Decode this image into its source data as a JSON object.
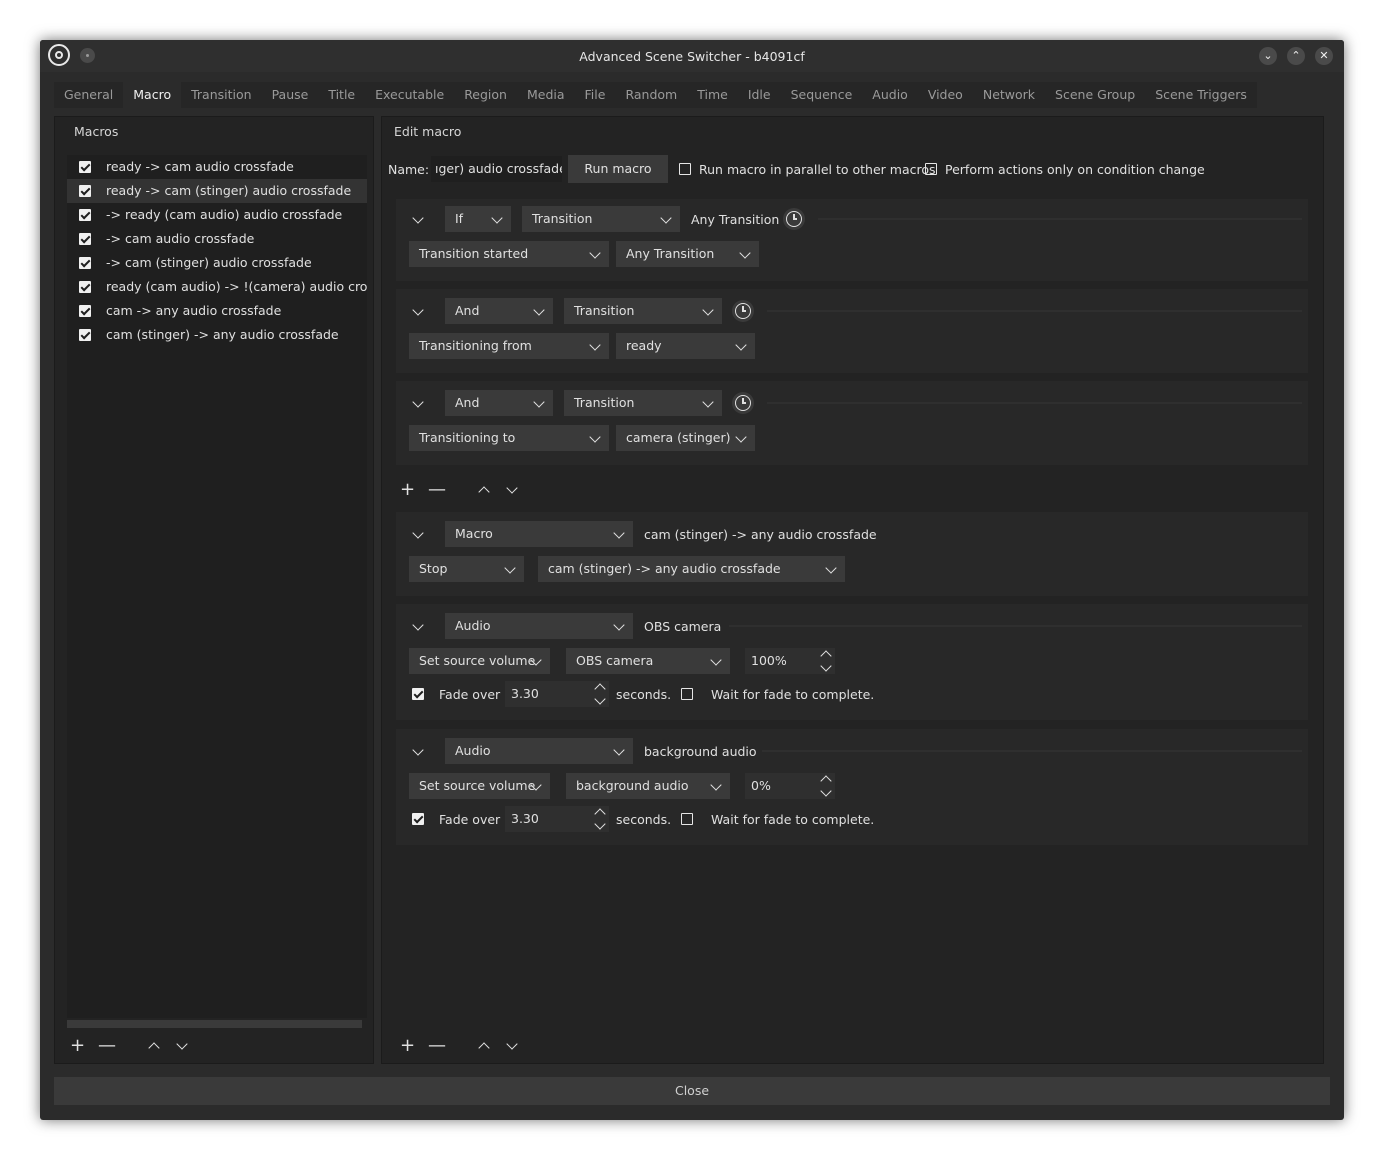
{
  "window": {
    "title": "Advanced Scene Switcher - b4091cf"
  },
  "tabs": [
    "General",
    "Macro",
    "Transition",
    "Pause",
    "Title",
    "Executable",
    "Region",
    "Media",
    "File",
    "Random",
    "Time",
    "Idle",
    "Sequence",
    "Audio",
    "Video",
    "Network",
    "Scene Group",
    "Scene Triggers"
  ],
  "active_tab": "Macro",
  "macros_panel": {
    "title": "Macros",
    "items": [
      {
        "label": "ready -> cam audio crossfade",
        "checked": true
      },
      {
        "label": "ready -> cam (stinger) audio crossfade",
        "checked": true,
        "selected": true
      },
      {
        "label": " -> ready (cam audio) audio crossfade",
        "checked": true
      },
      {
        "label": " -> cam audio crossfade",
        "checked": true
      },
      {
        "label": "-> cam (stinger) audio crossfade",
        "checked": true
      },
      {
        "label": "ready (cam audio) -> !(camera) audio crossfade",
        "checked": true
      },
      {
        "label": "cam -> any  audio crossfade",
        "checked": true
      },
      {
        "label": "cam (stinger) -> any audio crossfade",
        "checked": true
      }
    ]
  },
  "edit_panel": {
    "title": "Edit macro",
    "name_label": "Name:",
    "name_value": "ıger) audio crossfade",
    "run_macro": "Run macro",
    "parallel_label": "Run macro in parallel to other macros",
    "parallel_checked": false,
    "condition_change_label": "Perform actions only on condition change",
    "condition_change_checked": false
  },
  "conditions": [
    {
      "logic": "If",
      "type": "Transition",
      "summary": "Any Transition",
      "subtype": "Transition started",
      "target": "Any Transition"
    },
    {
      "logic": "And",
      "type": "Transition",
      "summary": "",
      "subtype": "Transitioning from",
      "target": "ready"
    },
    {
      "logic": "And",
      "type": "Transition",
      "summary": "",
      "subtype": "Transitioning to",
      "target": "camera (stinger)"
    }
  ],
  "actions": [
    {
      "type": "Macro",
      "summary": "cam (stinger) -> any audio crossfade",
      "action": "Stop",
      "target": "cam (stinger) -> any audio crossfade"
    },
    {
      "type": "Audio",
      "summary": "OBS camera",
      "action": "Set source volume",
      "source": "OBS camera",
      "volume": "100%",
      "fade_label": "Fade over",
      "fade_checked": true,
      "fade_value": "3.30",
      "seconds_label": "seconds.",
      "wait_label": "Wait for fade to complete.",
      "wait_checked": false
    },
    {
      "type": "Audio",
      "summary": "background audio",
      "action": "Set source volume",
      "source": "background audio",
      "volume": "0%",
      "fade_label": "Fade over",
      "fade_checked": true,
      "fade_value": "3.30",
      "seconds_label": "seconds.",
      "wait_label": "Wait for fade to complete.",
      "wait_checked": false
    }
  ],
  "controls": {
    "add": "+",
    "remove": "—"
  },
  "close_button": "Close"
}
